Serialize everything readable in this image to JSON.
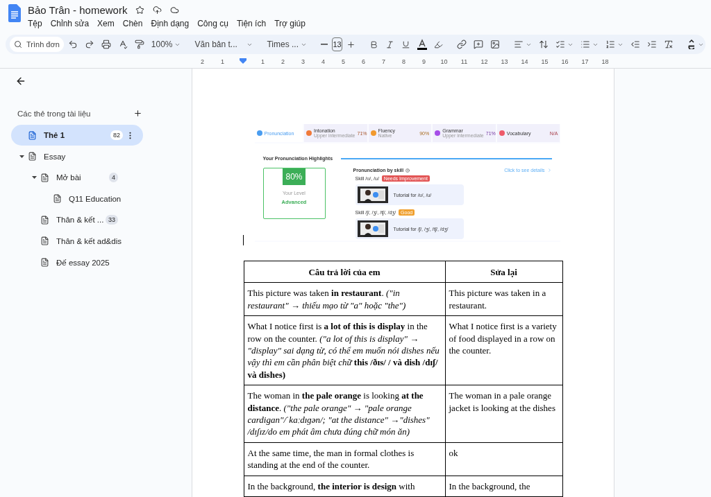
{
  "document": {
    "title": "Bảo Trân - homework"
  },
  "menu": [
    "Tệp",
    "Chỉnh sửa",
    "Xem",
    "Chèn",
    "Định dạng",
    "Công cụ",
    "Tiện ích",
    "Trợ giúp"
  ],
  "toolbar": {
    "search_placeholder": "Trình đơn",
    "zoom": "100%",
    "style": "Văn bản t...",
    "font": "Times ...",
    "font_size": "13"
  },
  "ruler": {
    "left_labels": [
      "2",
      "1"
    ],
    "right_labels": [
      "1",
      "2",
      "3",
      "4",
      "5",
      "6",
      "7",
      "8",
      "9",
      "10",
      "11",
      "12",
      "13",
      "14",
      "15",
      "16",
      "17",
      "18"
    ]
  },
  "sidebar": {
    "heading": "Các thẻ trong tài liệu",
    "items": [
      {
        "label": "Thẻ 1",
        "count": "82",
        "selected": true
      },
      {
        "label": "Essay",
        "selected": false,
        "expanded": true,
        "children": [
          {
            "label": "Mở bài",
            "count": "4",
            "selected": false,
            "expanded": true,
            "children": [
              {
                "label": "Q11 Education",
                "selected": false
              }
            ]
          },
          {
            "label": "Thân & kết ...",
            "count": "33",
            "selected": false
          },
          {
            "label": "Thân & kết ad&dis",
            "selected": false
          },
          {
            "label": "Đế essay 2025",
            "selected": false
          }
        ]
      }
    ]
  },
  "embedded_app": {
    "tabs": [
      {
        "name": "Pronunciation",
        "selected": true,
        "color": "#4a9df0"
      },
      {
        "name": "Intonation",
        "sub": "Upper intermediate",
        "score": "71%",
        "selected": false,
        "color": "#f07a3a"
      },
      {
        "name": "Fluency",
        "sub": "Native",
        "score": "90%",
        "selected": false,
        "color": "#f29a2e"
      },
      {
        "name": "Grammar",
        "sub": "Upper intermediate",
        "score": "71%",
        "selected": false,
        "color": "#a64ee8"
      },
      {
        "name": "Vocabulary",
        "score": "N/A",
        "selected": false,
        "color": "#ee5a6a"
      }
    ],
    "heading": "Your Pronunciation Highlights",
    "score": "80%",
    "level_label": "Your Level",
    "level": "Advanced",
    "skills_title": "Pronunciation by skill",
    "details_link": "Click to see details",
    "skills": [
      {
        "skill": "Skill /ʊ/, /u/",
        "tag": "Needs Improvement",
        "color": "#e25555",
        "tutorial": "Tutorial for /ʊ/, /u/"
      },
      {
        "skill": "Skill /ʃ/, /ʒ/, /tʃ/, /dʒ/",
        "tag": "Good",
        "color": "#f0a030",
        "tutorial": "Tutorial for /ʃ/, /ʒ/, /tʃ/, /dʒ/"
      }
    ]
  },
  "table": {
    "columns": [
      "Câu trả lời của em",
      "Sửa lại"
    ],
    "rows": [
      [
        "This picture was taken **in restaurant**. *(\"in restaurant\" → thiếu mạo từ \"a\" hoặc \"the\")*",
        "This picture was taken in a restaurant."
      ],
      [
        "What I notice first is **a lot of this is display** in the row on the counter. *(\"a lot of this is display\" → \"display\" sai dạng từ, có thể em muốn nói dishes nếu vậy thì em cần phân biệt chữ* **this /ðɪs/ / và dish /dɪʃ/ và dishes)**",
        "What I notice first is a variety of food displayed in a row on the counter."
      ],
      [
        "The woman in **the pale orange** is looking **at the distance**. *(\"the pale orange\" → \"pale orange cardigan\"/ˈkaːdɪɡən/; \"at the distance\" →\"dishes\" /dɪʃɪz/do em phát âm chưa đúng chữ món ăn)*",
        "The woman in a pale orange jacket is looking at the dishes"
      ],
      [
        "At the same time, the man in formal clothes is standing at the end of the counter.",
        "ok"
      ],
      [
        "In the background, **the interior is design** with",
        "In the background, the"
      ]
    ]
  }
}
